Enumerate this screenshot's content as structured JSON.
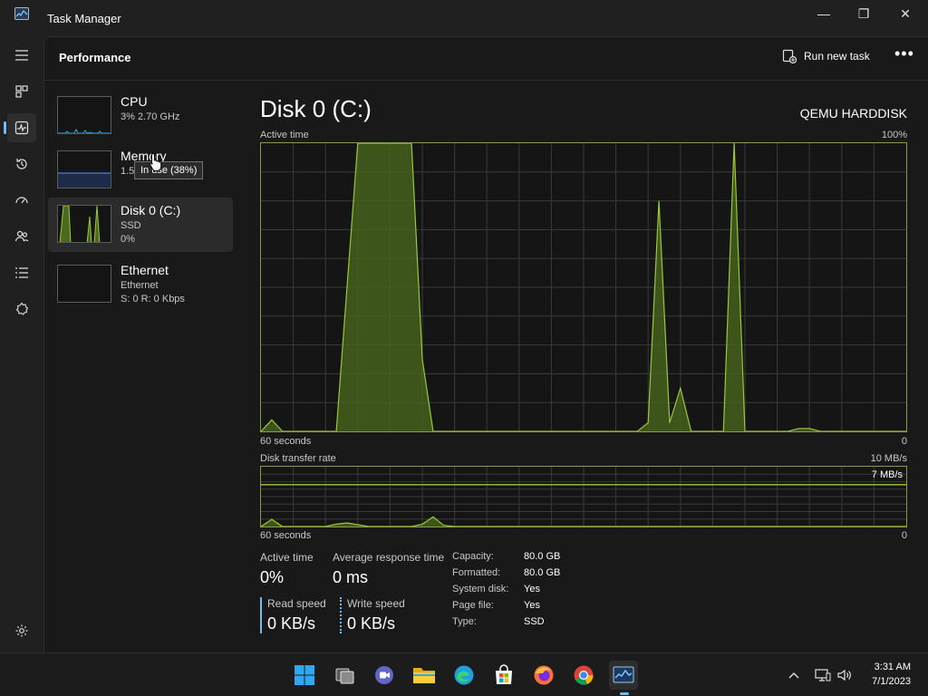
{
  "window": {
    "title": "Task Manager",
    "minimize_glyph": "—",
    "restore_glyph": "❐",
    "close_glyph": "✕"
  },
  "nav": {
    "items": [
      {
        "name": "hamburger-menu-icon",
        "active": false
      },
      {
        "name": "processes-icon",
        "active": false
      },
      {
        "name": "performance-icon",
        "active": true
      },
      {
        "name": "app-history-icon",
        "active": false
      },
      {
        "name": "startup-apps-icon",
        "active": false
      },
      {
        "name": "users-icon",
        "active": false
      },
      {
        "name": "details-icon",
        "active": false
      },
      {
        "name": "services-icon",
        "active": false
      }
    ],
    "settings_icon": "settings-gear-icon"
  },
  "header": {
    "page_title": "Performance",
    "run_new_task": "Run new task",
    "more_glyph": "•••"
  },
  "resources": [
    {
      "name": "CPU",
      "line1": "3% 2.70 GHz",
      "line2": ""
    },
    {
      "name": "Memory",
      "line1": "1.5",
      "line2": ""
    },
    {
      "name": "Disk 0 (C:)",
      "line1": "SSD",
      "line2": "0%"
    },
    {
      "name": "Ethernet",
      "line1": "Ethernet",
      "line2": "S: 0 R: 0 Kbps"
    }
  ],
  "tooltip": {
    "text": "In use (38%)"
  },
  "detail": {
    "title": "Disk 0 (C:)",
    "model": "QEMU HARDDISK",
    "active_time_label": "Active time",
    "active_time_max": "100%",
    "seconds_label": "60 seconds",
    "zero_label": "0",
    "transfer_label": "Disk transfer rate",
    "transfer_max": "10 MB/s",
    "transfer_line_label": "7 MB/s",
    "seconds_label_2": "60 seconds",
    "zero_label_2": "0"
  },
  "stats": {
    "active_time": {
      "label": "Active time",
      "value": "0%"
    },
    "avg_response": {
      "label": "Average response time",
      "value": "0 ms"
    },
    "read_speed": {
      "label": "Read speed",
      "value": "0 KB/s"
    },
    "write_speed": {
      "label": "Write speed",
      "value": "0 KB/s"
    }
  },
  "properties": [
    {
      "key": "Capacity:",
      "value": "80.0 GB"
    },
    {
      "key": "Formatted:",
      "value": "80.0 GB"
    },
    {
      "key": "System disk:",
      "value": "Yes"
    },
    {
      "key": "Page file:",
      "value": "Yes"
    },
    {
      "key": "Type:",
      "value": "SSD"
    }
  ],
  "colors": {
    "disk_line": "#9bc73b",
    "disk_fill": "#4b6a1c",
    "cpu_line": "#3ea8d8",
    "memory_line": "#4a7fd6",
    "accent": "#76b9ed",
    "grid": "#3a3a3a"
  },
  "active_time_series": {
    "x": [
      0,
      1,
      2,
      3,
      4,
      5,
      6,
      7,
      8,
      9,
      10,
      11,
      12,
      13,
      14,
      15,
      16,
      17,
      18,
      19,
      20,
      21,
      22,
      23,
      24,
      25,
      26,
      27,
      28,
      29,
      30,
      31,
      32,
      33,
      34,
      35,
      36,
      37,
      38,
      39,
      40,
      41,
      42,
      43,
      44,
      45,
      46,
      47,
      48,
      49,
      50,
      51,
      52,
      53,
      54,
      55,
      56,
      57,
      58,
      59,
      60
    ],
    "y": [
      0,
      4,
      0,
      0,
      0,
      0,
      0,
      0,
      50,
      100,
      100,
      100,
      100,
      100,
      100,
      25,
      0,
      0,
      0,
      0,
      0,
      0,
      0,
      0,
      0,
      0,
      0,
      0,
      0,
      0,
      0,
      0,
      0,
      0,
      0,
      0,
      3,
      80,
      3,
      15,
      0,
      0,
      0,
      0,
      100,
      0,
      0,
      0,
      0,
      0,
      1,
      1,
      0,
      0,
      0,
      0,
      0,
      0,
      0,
      0,
      0
    ]
  },
  "transfer_series": {
    "x": [
      0,
      1,
      2,
      3,
      4,
      5,
      6,
      7,
      8,
      9,
      10,
      11,
      12,
      13,
      14,
      15,
      16,
      17,
      18,
      19,
      20,
      21,
      22,
      23,
      24,
      25,
      26,
      27,
      28,
      29,
      30,
      31,
      32,
      33,
      34,
      35,
      36,
      37,
      38,
      39,
      40,
      41,
      42,
      43,
      44,
      45,
      46,
      47,
      48,
      49,
      50,
      51,
      52,
      53,
      54,
      55,
      56,
      57,
      58,
      59,
      60
    ],
    "y": [
      0,
      1.2,
      0,
      0,
      0,
      0,
      0,
      0.4,
      0.6,
      0.3,
      0,
      0,
      0,
      0,
      0,
      0.4,
      1.6,
      0.2,
      0,
      0,
      0,
      0,
      0,
      0,
      0,
      0,
      0,
      0,
      0,
      0,
      0,
      0,
      0,
      0,
      0,
      0,
      0,
      0,
      0,
      0,
      0,
      0,
      0,
      0,
      0,
      0,
      0,
      0,
      0,
      0,
      0,
      0,
      0,
      0,
      0,
      0,
      0,
      0,
      0,
      0,
      0
    ],
    "max": 10,
    "ref_line": 7
  },
  "taskbar": {
    "icons": [
      "windows-start-icon",
      "task-view-icon",
      "teams-chat-icon",
      "file-explorer-icon",
      "edge-browser-icon",
      "microsoft-store-icon",
      "firefox-icon",
      "chrome-icon",
      "task-manager-icon"
    ],
    "time": "3:31 AM",
    "date": "7/1/2023"
  }
}
